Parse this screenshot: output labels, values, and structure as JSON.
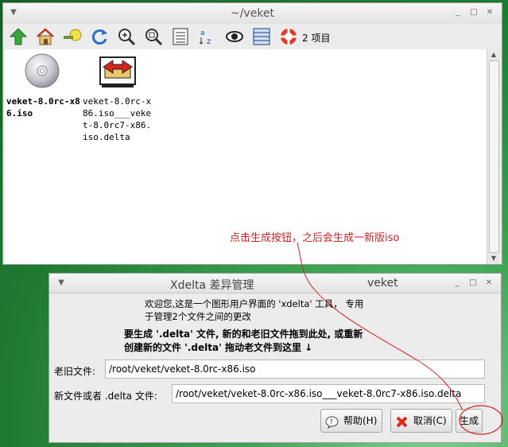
{
  "file_manager": {
    "title": "~/veket",
    "item_count": "2 项目",
    "toolbar_icons": [
      "up-arrow-icon",
      "home-icon",
      "bookmark-icon",
      "refresh-icon",
      "zoom-in-icon",
      "zoom-fit-icon",
      "list-view-icon",
      "sort-az-icon",
      "eye-icon",
      "detail-view-icon",
      "help-icon"
    ],
    "files": [
      {
        "name": "veket-8.0rc-x86.iso",
        "icon": "disc-icon"
      },
      {
        "name": "veket-8.0rc-x86.iso___veket-8.0rc7-x86.iso.delta",
        "icon": "delta-file-icon"
      }
    ]
  },
  "annotation": "点击生成按钮，之后会生成一新版iso",
  "xdelta": {
    "title_left": "Xdelta 差异管理",
    "title_right": "veket",
    "welcome_line1": "欢迎您,这是一个图形用户界面的 'xdelta' 工具， 专用",
    "welcome_line2": "于管理2个文件之间的更改",
    "instruction_line1": "要生成 '.delta' 文件, 新的和老旧文件拖到此处, 或重新",
    "instruction_line2": "创建新的文件 '.delta' 拖动老文件到这里 ↓",
    "old_file_label": "老旧文件:",
    "old_file_value": "/root/veket/veket-8.0rc-x86.iso",
    "new_file_label": "新文件或者 .delta 文件:",
    "new_file_value": "/root/veket/veket-8.0rc-x86.iso___veket-8.0rc7-x86.iso.delta",
    "help_button": "帮助(H)",
    "cancel_button": "取消(C)",
    "generate_button": "生成"
  },
  "colors": {
    "annotation": "#d42020",
    "desktop": "#2e8f3f"
  }
}
